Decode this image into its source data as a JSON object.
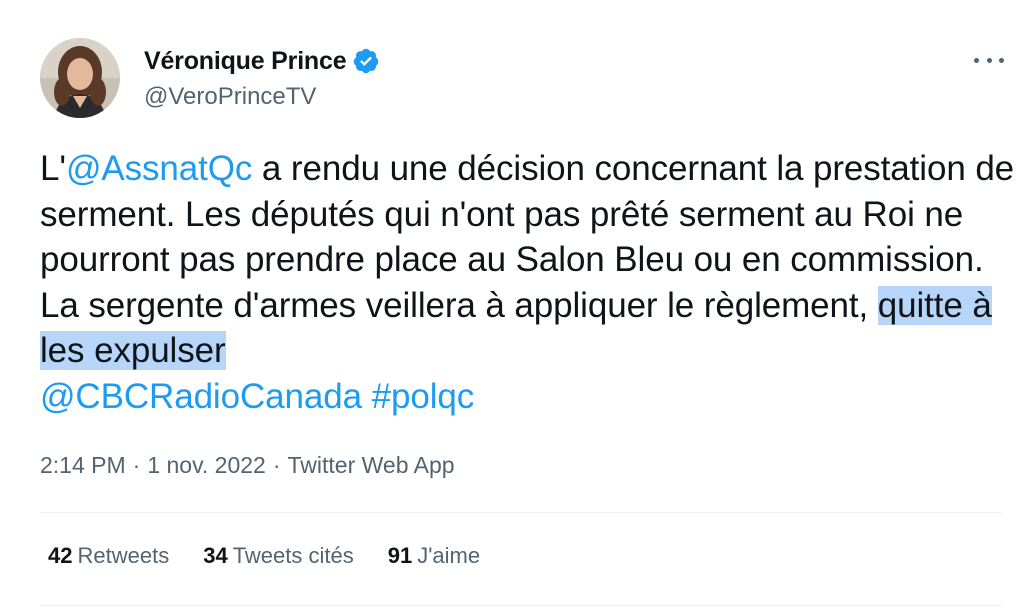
{
  "author": {
    "display_name": "Véronique Prince",
    "handle": "@VeroPrinceTV",
    "verified": true
  },
  "tweet": {
    "text_parts": {
      "p1": "L'",
      "mention1": "@AssnatQc",
      "p2": " a rendu une décision concernant la prestation de serment. Les députés qui n'ont pas prêté serment au Roi ne pourront pas prendre place au Salon Bleu ou en commission. La sergente d'armes veillera à appliquer le règlement, ",
      "highlighted": "quitte à les expulser",
      "mention2": "@CBCRadioCanada",
      "hashtag": "#polqc"
    }
  },
  "meta": {
    "time": "2:14 PM",
    "separator": "·",
    "date": "1 nov. 2022",
    "source": "Twitter Web App"
  },
  "stats": {
    "retweets_count": "42",
    "retweets_label": "Retweets",
    "quotes_count": "34",
    "quotes_label": "Tweets cités",
    "likes_count": "91",
    "likes_label": "J'aime"
  },
  "icons": {
    "verified": "verified-badge-icon",
    "more": "more-horizontal-icon"
  },
  "colors": {
    "link": "#1d9bf0",
    "secondary_text": "#536471",
    "highlight": "#b7d5f8"
  }
}
